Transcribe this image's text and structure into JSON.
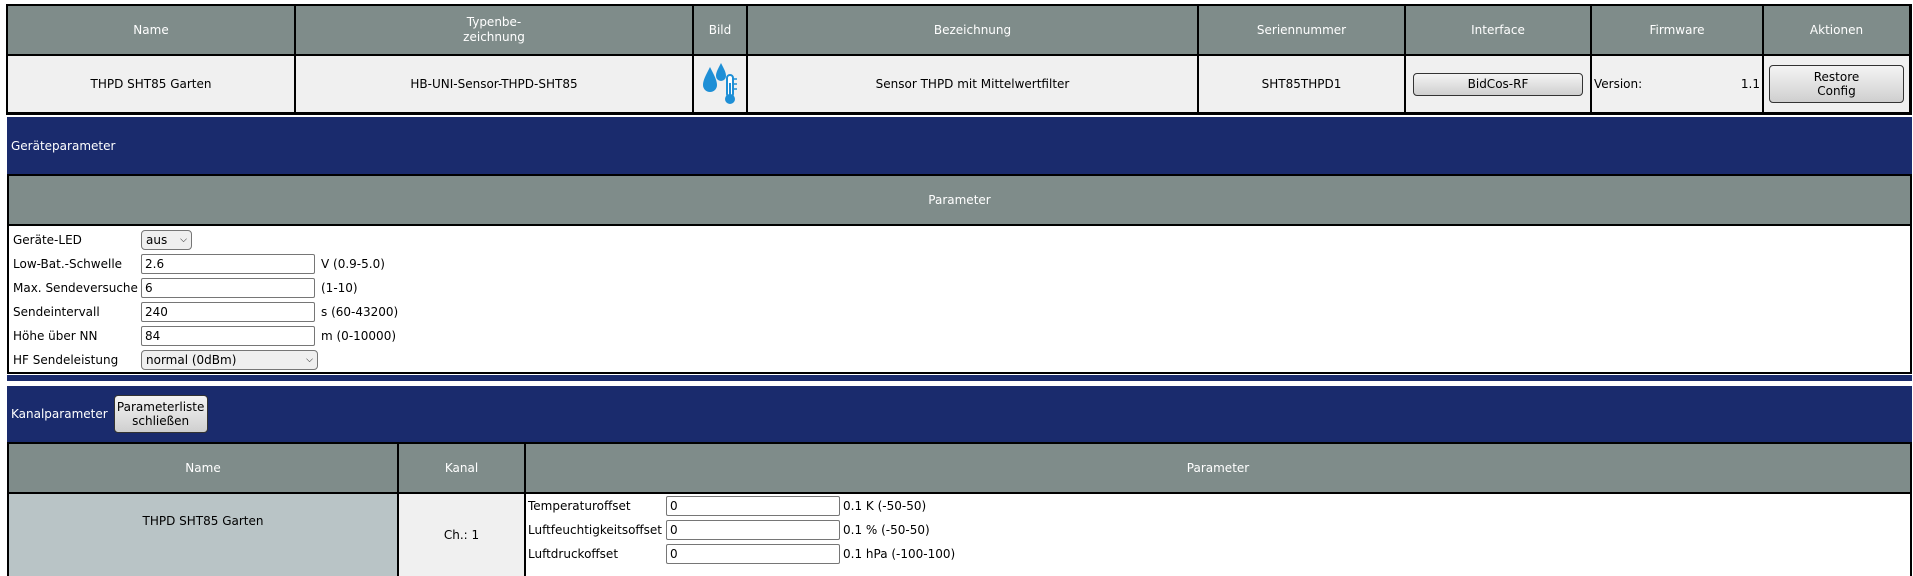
{
  "device_table": {
    "headers": {
      "name": "Name",
      "type": "Typenbe-\nzeichnung",
      "image": "Bild",
      "description": "Bezeichnung",
      "serial": "Seriennummer",
      "interface": "Interface",
      "firmware": "Firmware",
      "actions": "Aktionen"
    },
    "row": {
      "name": "THPD SHT85 Garten",
      "type": "HB-UNI-Sensor-THPD-SHT85",
      "image_icon": "humidity-thermometer-icon",
      "description": "Sensor THPD mit Mittelwertfilter",
      "serial": "SHT85THPD1",
      "interface_button": "BidCos-RF",
      "firmware_label": "Version:",
      "firmware_value": "1.1",
      "restore_button": "Restore\nConfig"
    }
  },
  "device_params": {
    "section_title": "Geräteparameter",
    "header": "Parameter",
    "rows": [
      {
        "label": "Geräte-LED",
        "kind": "select",
        "value": "aus",
        "unit": ""
      },
      {
        "label": "Low-Bat.-Schwelle",
        "kind": "input",
        "value": "2.6",
        "unit": "V (0.9-5.0)"
      },
      {
        "label": "Max. Sendeversuche",
        "kind": "input",
        "value": "6",
        "unit": "(1-10)"
      },
      {
        "label": "Sendeintervall",
        "kind": "input",
        "value": "240",
        "unit": "s (60-43200)"
      },
      {
        "label": "Höhe über NN",
        "kind": "input",
        "value": "84",
        "unit": "m (0-10000)"
      },
      {
        "label": "HF Sendeleistung",
        "kind": "select",
        "value": "normal (0dBm)",
        "unit": ""
      }
    ]
  },
  "channel_params": {
    "section_title": "Kanalparameter",
    "close_button": "Parameterliste\nschließen",
    "headers": {
      "name": "Name",
      "channel": "Kanal",
      "parameter": "Parameter"
    },
    "row": {
      "name": "THPD SHT85 Garten",
      "channel": "Ch.: 1",
      "params": [
        {
          "label": "Temperaturoffset",
          "value": "0",
          "unit": "0.1 K (-50-50)"
        },
        {
          "label": "Luftfeuchtigkeitsoffset",
          "value": "0",
          "unit": "0.1 % (-50-50)"
        },
        {
          "label": "Luftdruckoffset",
          "value": "0",
          "unit": "0.1 hPa (-100-100)"
        }
      ]
    }
  },
  "colors": {
    "header_bg": "#7f8c8a",
    "section_band": "#1a2b6d",
    "channel_name_bg": "#b9c4c6",
    "row_bg": "#f0f0f0",
    "icon_blue": "#1e8fd6"
  }
}
